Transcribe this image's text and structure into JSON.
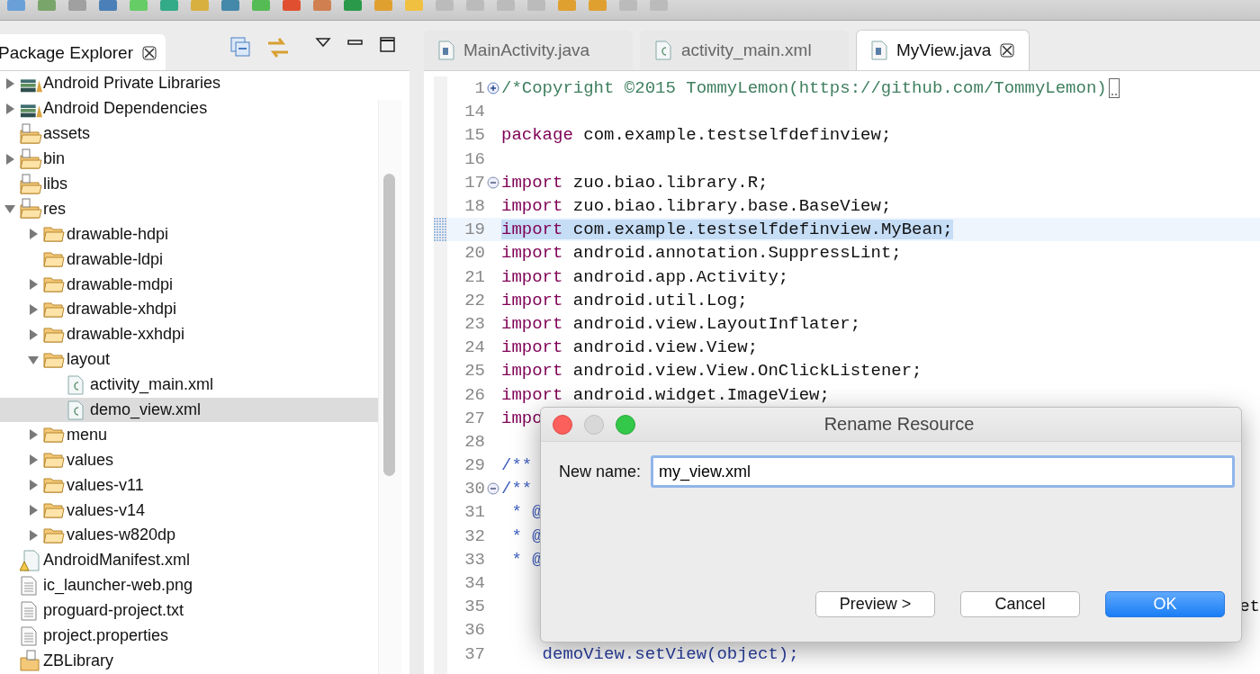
{
  "explorer": {
    "tab": {
      "label": "Package Explorer",
      "selected": true
    },
    "project_children": [
      {
        "label": "Android Private Libraries",
        "kind": "library",
        "expanded": false,
        "selected": false
      },
      {
        "label": "Android Dependencies",
        "kind": "library",
        "expanded": false,
        "selected": false
      },
      {
        "label": "assets",
        "kind": "source-folder",
        "selected": false
      },
      {
        "label": "bin",
        "kind": "source-folder",
        "expanded": false,
        "selected": false
      },
      {
        "label": "libs",
        "kind": "source-folder",
        "selected": false
      },
      {
        "label": "res",
        "kind": "source-folder",
        "expanded": true,
        "selected": false,
        "children": [
          {
            "label": "drawable-hdpi",
            "kind": "folder",
            "expanded": false,
            "selected": false
          },
          {
            "label": "drawable-ldpi",
            "kind": "folder",
            "selected": false
          },
          {
            "label": "drawable-mdpi",
            "kind": "folder",
            "expanded": false,
            "selected": false
          },
          {
            "label": "drawable-xhdpi",
            "kind": "folder",
            "expanded": false,
            "selected": false
          },
          {
            "label": "drawable-xxhdpi",
            "kind": "folder",
            "expanded": false,
            "selected": false
          },
          {
            "label": "layout",
            "kind": "folder",
            "expanded": true,
            "selected": false,
            "children": [
              {
                "label": "activity_main.xml",
                "kind": "xml",
                "selected": false
              },
              {
                "label": "demo_view.xml",
                "kind": "xml",
                "selected": true
              }
            ]
          },
          {
            "label": "menu",
            "kind": "folder",
            "expanded": false,
            "selected": false
          },
          {
            "label": "values",
            "kind": "folder",
            "expanded": false,
            "selected": false
          },
          {
            "label": "values-v11",
            "kind": "folder",
            "expanded": false,
            "selected": false
          },
          {
            "label": "values-v14",
            "kind": "folder",
            "expanded": false,
            "selected": false
          },
          {
            "label": "values-w820dp",
            "kind": "folder",
            "expanded": false,
            "selected": false
          }
        ]
      },
      {
        "label": "AndroidManifest.xml",
        "kind": "manifest",
        "selected": false
      },
      {
        "label": "ic_launcher-web.png",
        "kind": "text-file",
        "selected": false
      },
      {
        "label": "proguard-project.txt",
        "kind": "text-file",
        "selected": false
      },
      {
        "label": "project.properties",
        "kind": "text-file",
        "selected": false
      }
    ],
    "projects": [
      {
        "label": "ZBLibrary",
        "kind": "project",
        "selected": false
      }
    ]
  },
  "editor": {
    "tabs": [
      {
        "label": "MainActivity.java",
        "kind": "java",
        "selected": false
      },
      {
        "label": "activity_main.xml",
        "kind": "xml",
        "selected": false
      },
      {
        "label": "MyView.java",
        "kind": "java",
        "selected": true
      }
    ],
    "lines": [
      {
        "number": "1",
        "collapsed": true,
        "parts": [
          {
            "kind": "comment",
            "text": "/*Copyright ©2015 TommyLemon(https://github.com/TommyLemon)"
          }
        ],
        "folded_marker": true
      },
      {
        "number": "14"
      },
      {
        "number": "15",
        "parts": [
          {
            "kind": "keyword",
            "text": "package"
          },
          {
            "kind": "plain",
            "text": " com.example.testselfdefinview;"
          }
        ]
      },
      {
        "number": "16"
      },
      {
        "number": "17",
        "collapsed": false,
        "parts": [
          {
            "kind": "keyword",
            "text": "import"
          },
          {
            "kind": "plain",
            "text": " zuo.biao.library.R;"
          }
        ]
      },
      {
        "number": "18",
        "parts": [
          {
            "kind": "keyword",
            "text": "import"
          },
          {
            "kind": "plain",
            "text": " zuo.biao.library.base.BaseView;"
          }
        ]
      },
      {
        "number": "19",
        "selected": true,
        "parts": [
          {
            "kind": "keyword",
            "text": "import"
          },
          {
            "kind": "plain",
            "text": " com.example.testselfdefinview.MyBean;"
          }
        ]
      },
      {
        "number": "20",
        "parts": [
          {
            "kind": "keyword",
            "text": "import"
          },
          {
            "kind": "plain",
            "text": " android.annotation.SuppressLint;"
          }
        ]
      },
      {
        "number": "21",
        "parts": [
          {
            "kind": "keyword",
            "text": "import"
          },
          {
            "kind": "plain",
            "text": " android.app.Activity;"
          }
        ]
      },
      {
        "number": "22",
        "parts": [
          {
            "kind": "keyword",
            "text": "import"
          },
          {
            "kind": "plain",
            "text": " android.util.Log;"
          }
        ]
      },
      {
        "number": "23",
        "parts": [
          {
            "kind": "keyword",
            "text": "import"
          },
          {
            "kind": "plain",
            "text": " android.view.LayoutInflater;"
          }
        ]
      },
      {
        "number": "24",
        "parts": [
          {
            "kind": "keyword",
            "text": "import"
          },
          {
            "kind": "plain",
            "text": " android.view.View;"
          }
        ]
      },
      {
        "number": "25",
        "parts": [
          {
            "kind": "keyword",
            "text": "import"
          },
          {
            "kind": "plain",
            "text": " android.view.View.OnClickListener;"
          }
        ]
      },
      {
        "number": "26",
        "parts": [
          {
            "kind": "keyword",
            "text": "import"
          },
          {
            "kind": "plain",
            "text": " android.widget.ImageView;"
          }
        ]
      },
      {
        "number": "27",
        "parts": [
          {
            "kind": "keyword",
            "text": "impo"
          }
        ]
      },
      {
        "number": "28"
      },
      {
        "number": "29",
        "parts": [
          {
            "kind": "javadoc",
            "text": "/**"
          }
        ]
      },
      {
        "number": "30",
        "collapsed": false,
        "parts": [
          {
            "kind": "javadoc",
            "text": "/**"
          }
        ]
      },
      {
        "number": "31",
        "parts": [
          {
            "kind": "javadoc",
            "text": " * @"
          }
        ]
      },
      {
        "number": "32",
        "parts": [
          {
            "kind": "javadoc",
            "text": " * @"
          }
        ]
      },
      {
        "number": "33",
        "parts": [
          {
            "kind": "javadoc",
            "text": " * @"
          }
        ]
      },
      {
        "number": "34"
      },
      {
        "number": "35",
        "tail": "et"
      },
      {
        "number": "36"
      },
      {
        "number": "37",
        "parts": [
          {
            "kind": "code",
            "text": "    demoView.setView(object);"
          }
        ]
      }
    ]
  },
  "dialog": {
    "title": "Rename Resource",
    "field": {
      "label": "New name:",
      "value": "my_view.xml"
    },
    "buttons": [
      {
        "label": "Preview >",
        "default": false
      },
      {
        "label": "Cancel",
        "default": false
      },
      {
        "label": "OK",
        "default": true
      }
    ]
  }
}
